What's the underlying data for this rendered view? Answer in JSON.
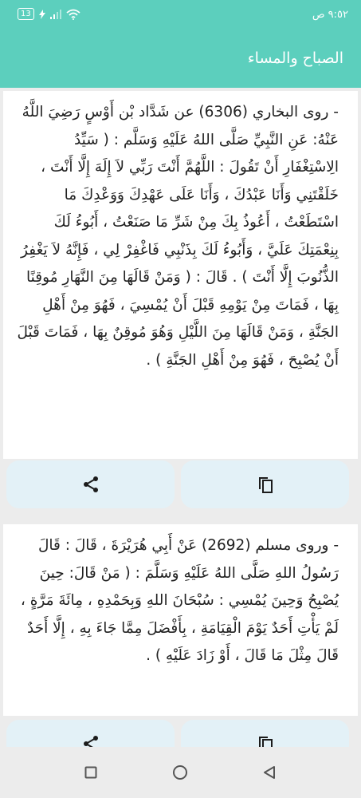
{
  "status_bar": {
    "time": "٩:٥٢ ص",
    "battery": "13",
    "signal_icon": "signal-icon",
    "wifi_icon": "wifi-icon",
    "charging_icon": "lightning-icon"
  },
  "app_bar": {
    "title": "الصباح والمساء",
    "background": "#5ccfbd"
  },
  "cards": [
    {
      "text": "- روى البخاري (6306) عن شَدَّاد بْن أَوْسٍ رَضِيَ اللَّهُ عَنْهُ: عَنِ النَّبِيِّ صَلَّى اللهُ عَلَيْهِ وَسَلَّم : ( سَيِّدُ الِاسْتِغْفَارِ أَنْ تَقُولَ : اللَّهُمَّ أَنْتَ رَبِّي لاَ إِلَهَ إِلَّا أَنْتَ ، خَلَقْتَنِي وَأَنَا عَبْدُكَ ، وَأَنَا عَلَى عَهْدِكَ وَوَعْدِكَ مَا اسْتَطَعْتُ ، أَعُوذُ بِكَ مِنْ شَرِّ مَا صَنَعْتُ ، أَبُوءُ لَكَ بِنِعْمَتِكَ عَلَيَّ ، وَأَبُوءُ لَكَ بِذَنْبِي فَاغْفِرْ لِي ، فَإِنَّهُ لاَ يَغْفِرُ الذُّنُوبَ إِلَّا أَنْتَ ) . قَالَ : ( وَمَنْ قَالَهَا مِنَ النَّهَارِ مُوقِنًا بِهَا ، فَمَاتَ مِنْ يَوْمِهِ قَبْلَ أَنْ يُمْسِيَ ، فَهُوَ مِنْ أَهْلِ الجَنَّةِ ، وَمَنْ قَالَهَا مِنَ اللَّيْلِ وَهُوَ مُوقِنٌ بِهَا ، فَمَاتَ قَبْلَ أَنْ يُصْبِحَ ، فَهُوَ مِنْ أَهْلِ الجَنَّةِ ) ."
    },
    {
      "text": "- وروى مسلم (2692) عَنْ أَبِي هُرَيْرَةَ ، قَالَ : قَالَ رَسُولُ اللهِ صَلَّى اللهُ عَلَيْهِ وَسَلَّمَ : ( مَنْ قَالَ: حِينَ يُصْبِحُ وَحِينَ يُمْسِي : سُبْحَانَ اللهِ وَبِحَمْدِهِ ، مِائَةَ مَرَّةٍ ، لَمْ يَأْتِ أَحَدٌ يَوْمَ الْقِيَامَةِ ، بِأَفْضَلَ مِمَّا جَاءَ بِهِ ، إِلَّا أَحَدٌ قَالَ مِثْلَ مَا قَالَ ، أَوْ زَادَ عَلَيْهِ ) ."
    }
  ],
  "icons": {
    "share": "share-icon",
    "copy": "copy-icon",
    "nav_recents": "square-icon",
    "nav_home": "circle-icon",
    "nav_back": "triangle-back-icon"
  },
  "colors": {
    "accent": "#5ccfbd",
    "button_bg": "#e3f1f7"
  }
}
